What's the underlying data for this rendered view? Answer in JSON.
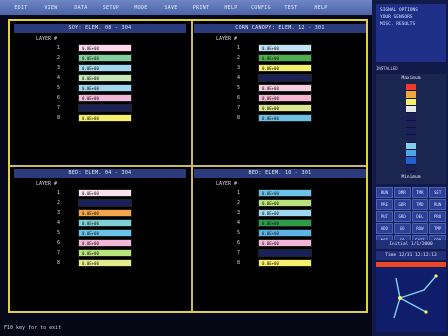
{
  "menu": [
    "EDIT",
    "VIEW",
    "DATA",
    "SETUP",
    "MODE",
    "SAVE",
    "PRINT",
    "HELP",
    "CONFIG",
    "TEST",
    "HELP"
  ],
  "quadrants": [
    {
      "title": "SOY: ELEM. 08 - 304",
      "layer_head": "LAYER #",
      "rows": [
        {
          "n": "1",
          "val": "0.0E+00",
          "color": "#ffd6ea"
        },
        {
          "n": "2",
          "val": "0.0E+00",
          "color": "#7fd09a"
        },
        {
          "n": "3",
          "val": "0.0E+00",
          "color": "#9fd7f0"
        },
        {
          "n": "4",
          "val": "0.0E+00",
          "color": "#c6e8b7"
        },
        {
          "n": "5",
          "val": "0.0E+00",
          "color": "#9fd7f0"
        },
        {
          "n": "6",
          "val": "0.0E+00",
          "color": "#f4b6d8"
        },
        {
          "n": "7",
          "val": "",
          "color": "#1a2058"
        },
        {
          "n": "8",
          "val": "0.0E+00",
          "color": "#f4f06a"
        }
      ]
    },
    {
      "title": "CORN CANOPY: ELEM. 12 - 301",
      "layer_head": "LAYER #",
      "rows": [
        {
          "n": "1",
          "val": "0.0E+00",
          "color": "#bfe4f5"
        },
        {
          "n": "2",
          "val": "0.0E+00",
          "color": "#4cb14a"
        },
        {
          "n": "3",
          "val": "0.0E+00",
          "color": "#f4f06a"
        },
        {
          "n": "4",
          "val": "",
          "color": "#1a2058"
        },
        {
          "n": "5",
          "val": "0.0E+00",
          "color": "#f6cfe0"
        },
        {
          "n": "6",
          "val": "0.0E+00",
          "color": "#f7b3cf"
        },
        {
          "n": "7",
          "val": "0.0E+00",
          "color": "#d9e68a"
        },
        {
          "n": "8",
          "val": "0.0E+00",
          "color": "#6cc1e6"
        }
      ]
    },
    {
      "title": "BED: ELEM. 04 - 304",
      "layer_head": "LAYER #",
      "rows": [
        {
          "n": "1",
          "val": "0.0E+00",
          "color": "#fbe1ee"
        },
        {
          "n": "2",
          "val": "",
          "color": "#1a2058"
        },
        {
          "n": "3",
          "val": "0.0E+00",
          "color": "#f2a64a"
        },
        {
          "n": "4",
          "val": "0.0E+00",
          "color": "#7fd0d6"
        },
        {
          "n": "5",
          "val": "0.0E+00",
          "color": "#6cc1e6"
        },
        {
          "n": "6",
          "val": "0.0E+00",
          "color": "#f4b6d8"
        },
        {
          "n": "7",
          "val": "0.0E+00",
          "color": "#b8e27a"
        },
        {
          "n": "8",
          "val": "0.0E+00",
          "color": "#e4eb8a"
        }
      ]
    },
    {
      "title": "BED: ELEM. 10 - 301",
      "layer_head": "LAYER #",
      "rows": [
        {
          "n": "1",
          "val": "0.0E+00",
          "color": "#6cc1e6"
        },
        {
          "n": "2",
          "val": "0.0E+00",
          "color": "#b8e27a"
        },
        {
          "n": "3",
          "val": "0.0E+00",
          "color": "#9fd7f0"
        },
        {
          "n": "4",
          "val": "0.0E+00",
          "color": "#2e9a4a"
        },
        {
          "n": "5",
          "val": "0.0E+00",
          "color": "#5bb3e6"
        },
        {
          "n": "6",
          "val": "0.0E+00",
          "color": "#f4b6d8"
        },
        {
          "n": "7",
          "val": "",
          "color": "#1a2058"
        },
        {
          "n": "8",
          "val": "0.0E+00",
          "color": "#f4f06a"
        }
      ]
    }
  ],
  "status": "F10 key for to exit",
  "side": {
    "info_lines": [
      "SIGNAL OPTIONS",
      "YOUR SENSORS",
      "MISC. RESULTS"
    ],
    "mode_label": "INSTALLED",
    "scale_max": "Maximum",
    "scale_min": "Minimum",
    "scale_colors": [
      "#f23a2a",
      "#f2a73a",
      "#f4f06a",
      "#e8e8e8",
      "#1a2058",
      "#1a2058",
      "#1a2058",
      "#1a2058",
      "#7fd0f0",
      "#4aa8e6",
      "#1f5fd0",
      "#1a2058"
    ],
    "grid_buttons": [
      "RUN",
      "DMR",
      "TMR",
      "SET",
      "PRE",
      "GDR",
      "TMD",
      "RUN",
      "PUT",
      "GRD",
      "DEL",
      "PRO",
      "ADD",
      "GO",
      "ROW",
      "TMP",
      "NOT",
      "GO",
      "EXIT",
      "GRD"
    ],
    "time_1": "Initial 1/1/2000",
    "time_2": "Time 12/31 12:12:13"
  }
}
